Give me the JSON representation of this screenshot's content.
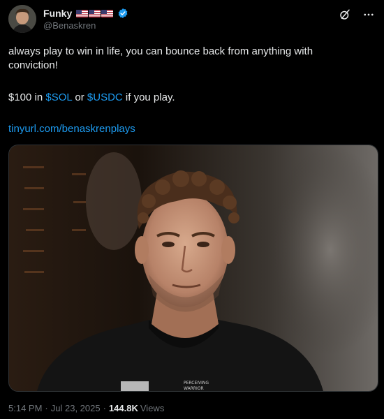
{
  "author": {
    "display_name": "Funky",
    "handle": "@Benaskren",
    "flags": [
      "us-flag",
      "us-flag",
      "us-flag"
    ],
    "verified": true
  },
  "tweet": {
    "line1": "always play to win in life, you can bounce back from anything with",
    "line2": "conviction!",
    "line3_prefix": "$100 in ",
    "cashtag1": "$SOL",
    "line3_mid": " or ",
    "cashtag2": "$USDC",
    "line3_suffix": " if you play.",
    "link": "tinyurl.com/benaskrenplays"
  },
  "footer": {
    "time": "5:14 PM",
    "separator": "·",
    "date": "Jul 23, 2025",
    "views_count": "144.8K",
    "views_label": "Views"
  },
  "colors": {
    "background": "#000000",
    "text": "#e7e9ea",
    "secondary": "#71767b",
    "link": "#1d9bf0",
    "verified": "#1d9bf0"
  }
}
